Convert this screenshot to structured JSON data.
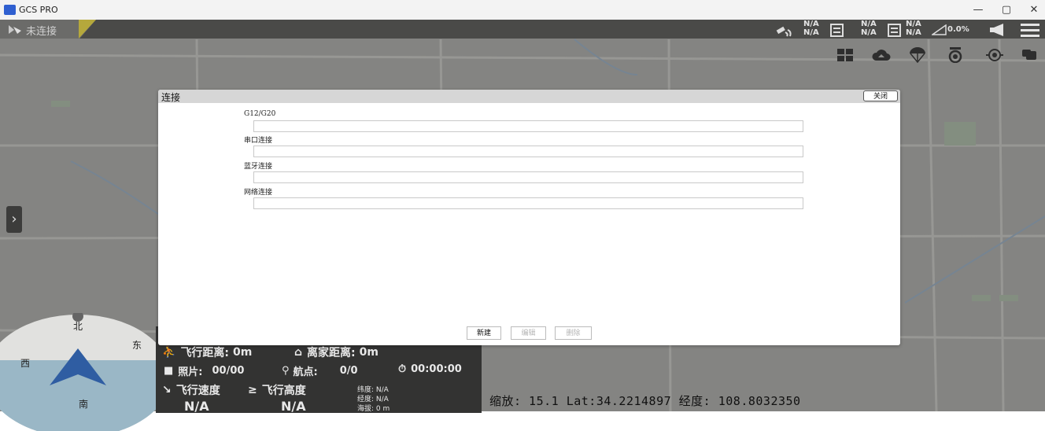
{
  "window": {
    "title": "GCS PRO",
    "controls": {
      "minimize": "—",
      "restore": "▢",
      "close": "✕"
    }
  },
  "topbar": {
    "connection_status": "未连接",
    "telemetry_1": {
      "top": "N/A",
      "bottom": "N/A"
    },
    "telemetry_2": {
      "top": "N/A",
      "bottom": "N/A"
    },
    "telemetry_3": {
      "top": "N/A",
      "bottom": "N/A"
    },
    "signal_percent": "0.0%",
    "icons": [
      "satellite-icon",
      "document-icon",
      "document-icon",
      "signal-icon",
      "megaphone-icon",
      "menu-icon"
    ]
  },
  "quick_buttons": [
    "layers-icon",
    "cloud-upload-icon",
    "parachute-icon",
    "camera-lens-icon",
    "target-icon",
    "chat-icon"
  ],
  "sidebar": {
    "expand_label": "›"
  },
  "compass": {
    "north": "北",
    "east": "东",
    "west": "西",
    "south": "南"
  },
  "telemetry": {
    "flight_distance_label": "飞行距离:",
    "flight_distance_value": "0m",
    "home_distance_label": "离家距离:",
    "home_distance_value": "0m",
    "photos_label": "照片:",
    "photos_value": "00/00",
    "waypoints_label": "航点:",
    "waypoints_value": "0/0",
    "timer_value": "00:00:00",
    "speed_label": "飞行速度",
    "speed_value": "N/A",
    "altitude_label": "飞行高度",
    "altitude_value": "N/A",
    "latitude_line": "纬度: N/A",
    "longitude_line": "经度: N/A",
    "elevation_line": "海拔: 0 m"
  },
  "map_status": "缩放: 15.1  Lat:34.2214897   经度: 108.8032350",
  "dialog": {
    "title": "连接",
    "close_label": "关闭",
    "sections": [
      {
        "label": "G12/G20",
        "value": ""
      },
      {
        "label": "串口连接",
        "value": ""
      },
      {
        "label": "蓝牙连接",
        "value": ""
      },
      {
        "label": "网络连接",
        "value": ""
      }
    ],
    "buttons": {
      "new": "新建",
      "edit": "编辑",
      "delete": "删除"
    }
  },
  "colors": {
    "topbar": "#4a4a48",
    "panel": "#333332",
    "compass_ring": "#e1e1df",
    "compass_lower": "#9ab7c6",
    "arrow": "#2f5da2",
    "warning_stripe": "#b5a83c"
  }
}
